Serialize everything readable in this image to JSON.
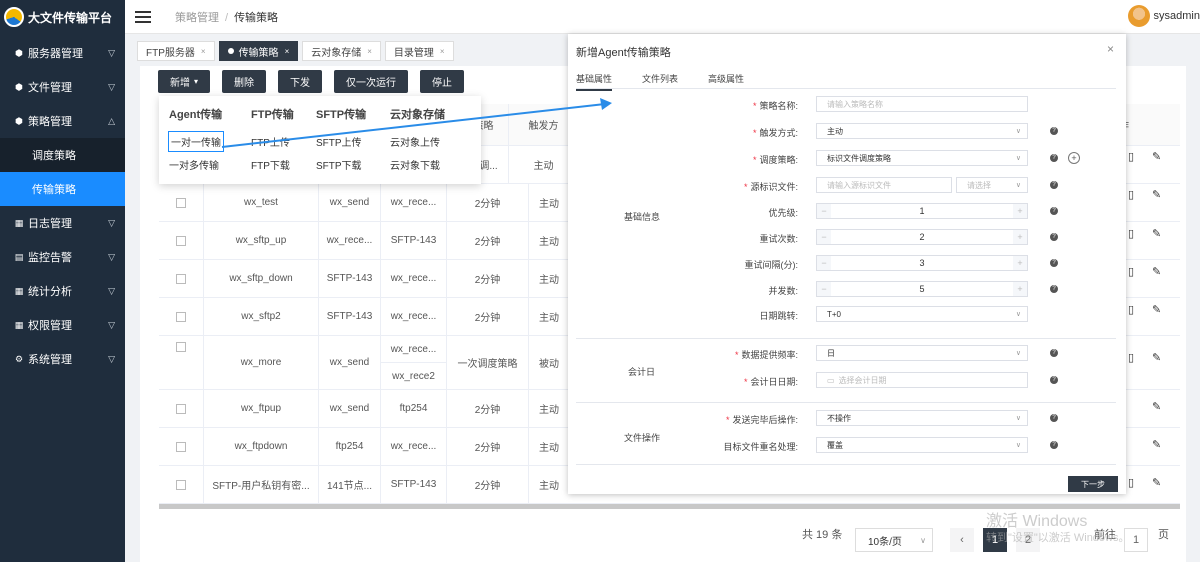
{
  "app": {
    "title": "大文件传输平台"
  },
  "sidebar": {
    "items": [
      {
        "label": "服务器管理",
        "icon": "server-icon"
      },
      {
        "label": "文件管理",
        "icon": "folder-icon"
      },
      {
        "label": "策略管理",
        "icon": "strategy-icon",
        "expanded": true
      },
      {
        "label": "日志管理",
        "icon": "log-icon"
      },
      {
        "label": "监控告警",
        "icon": "monitor-icon"
      },
      {
        "label": "统计分析",
        "icon": "chart-icon"
      },
      {
        "label": "权限管理",
        "icon": "permission-icon"
      },
      {
        "label": "系统管理",
        "icon": "settings-icon"
      }
    ],
    "subitems": [
      {
        "label": "调度策略"
      },
      {
        "label": "传输策略",
        "active": true
      }
    ]
  },
  "header": {
    "breadcrumb": [
      "策略管理",
      "传输策略"
    ],
    "user": "sysadmin"
  },
  "tabs": [
    {
      "label": "FTP服务器"
    },
    {
      "label": "传输策略",
      "active": true
    },
    {
      "label": "云对象存储"
    },
    {
      "label": "目录管理"
    }
  ],
  "toolbar": {
    "add": "新增",
    "delete": "删除",
    "deploy": "下发",
    "run_once": "仅一次运行",
    "stop": "停止"
  },
  "dropdown": {
    "columns": [
      {
        "title": "Agent传输",
        "items": [
          "一对一传输",
          "一对多传输"
        ]
      },
      {
        "title": "FTP传输",
        "items": [
          "FTP上传",
          "FTP下载"
        ]
      },
      {
        "title": "SFTP传输",
        "items": [
          "SFTP上传",
          "SFTP下载"
        ]
      },
      {
        "title": "云对象存储",
        "items": [
          "云对象上传",
          "云对象下载"
        ]
      }
    ]
  },
  "table": {
    "headers": [
      "度策略",
      "触发方",
      "作"
    ],
    "rows": [
      {
        "name": "",
        "src": "",
        "dst": "",
        "interval": "文件调...",
        "trigger": "主动"
      },
      {
        "name": "wx_test",
        "src": "wx_send",
        "dst": "wx_rece...",
        "interval": "2分钟",
        "trigger": "主动"
      },
      {
        "name": "wx_sftp_up",
        "src": "wx_rece...",
        "dst": "SFTP-143",
        "interval": "2分钟",
        "trigger": "主动"
      },
      {
        "name": "wx_sftp_down",
        "src": "SFTP-143",
        "dst": "wx_rece...",
        "interval": "2分钟",
        "trigger": "主动"
      },
      {
        "name": "wx_sftp2",
        "src": "SFTP-143",
        "dst": "wx_rece...",
        "interval": "2分钟",
        "trigger": "主动"
      },
      {
        "name": "wx_more",
        "src": "wx_send",
        "dst": "wx_rece...",
        "dst2": "wx_rece2",
        "interval": "一次调度策略",
        "trigger": "被动"
      },
      {
        "name": "wx_ftpup",
        "src": "wx_send",
        "dst": "ftp254",
        "interval": "2分钟",
        "trigger": "主动"
      },
      {
        "name": "wx_ftpdown",
        "src": "ftp254",
        "dst": "wx_rece...",
        "interval": "2分钟",
        "trigger": "主动"
      },
      {
        "name": "SFTP-用户私钥有密...",
        "src": "141节点...",
        "dst": "SFTP-143",
        "interval": "2分钟",
        "trigger": "主动"
      }
    ]
  },
  "pagination": {
    "total": "共 19 条",
    "page_size": "10条/页",
    "pages": [
      "1",
      "2"
    ],
    "goto_label": "前往",
    "goto_value": "1",
    "page_suffix": "页"
  },
  "dialog": {
    "title": "新增Agent传输策略",
    "tabs": [
      "基础属性",
      "文件列表",
      "高级属性"
    ],
    "sections": [
      "基础信息",
      "会计日",
      "文件操作"
    ],
    "fields": {
      "name": {
        "label": "策略名称:",
        "placeholder": "请输入策略名称"
      },
      "trigger": {
        "label": "触发方式:",
        "value": "主动"
      },
      "schedule": {
        "label": "调度策略:",
        "value": "标识文件调度策略"
      },
      "source_file": {
        "label": "源标识文件:",
        "placeholder": "请输入源标识文件",
        "select": "请选择"
      },
      "priority": {
        "label": "优先级:",
        "value": "1"
      },
      "retries": {
        "label": "重试次数:",
        "value": "2"
      },
      "retry_interval": {
        "label": "重试间隔(分):",
        "value": "3"
      },
      "concurrency": {
        "label": "并发数:",
        "value": "5"
      },
      "date_jump": {
        "label": "日期跳转:",
        "value": "T+0"
      },
      "data_freq": {
        "label": "数据提供频率:",
        "value": "日"
      },
      "account_date": {
        "label": "会计日日期:",
        "placeholder": "选择会计日期"
      },
      "after_send": {
        "label": "发送完毕后操作:",
        "value": "不操作"
      },
      "rename": {
        "label": "目标文件重名处理:",
        "value": "覆盖"
      }
    },
    "next": "下一步"
  },
  "watermark": {
    "line1": "激活 Windows",
    "line2": "转到\"设置\"以激活 Windows。"
  },
  "colors": {
    "sidebar": "#1f2d3d",
    "accent": "#1a8cff",
    "dark_button": "#303a46"
  }
}
